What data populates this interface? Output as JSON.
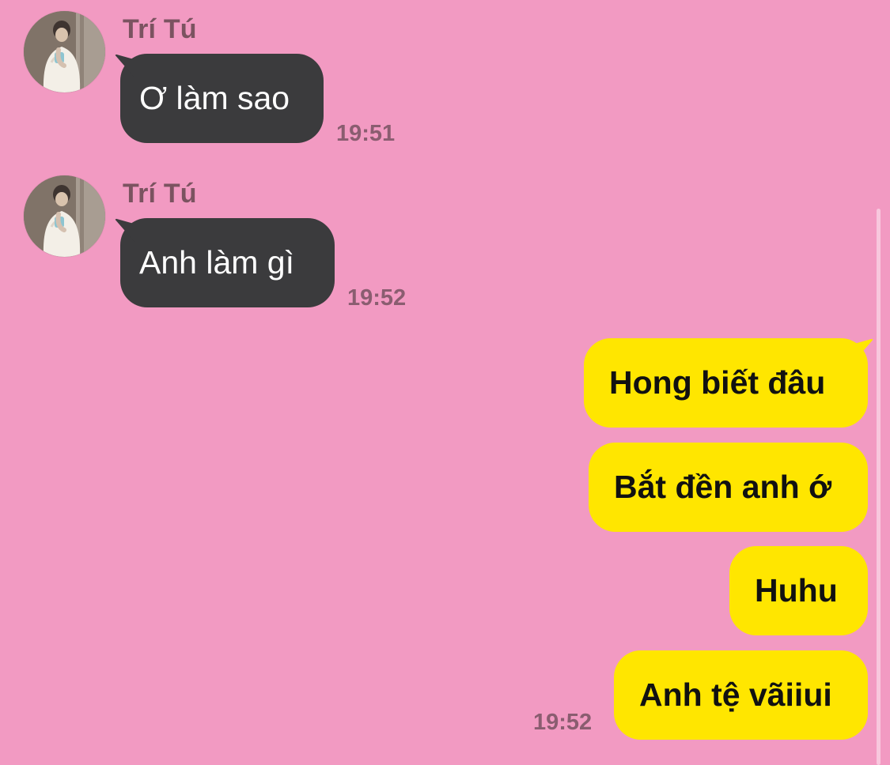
{
  "conversation": {
    "messages_in": [
      {
        "sender": "Trí Tú",
        "text": "Ơ làm sao",
        "time": "19:51"
      },
      {
        "sender": "Trí Tú",
        "text": "Anh làm gì",
        "time": "19:52"
      }
    ],
    "messages_out": [
      {
        "text": "Hong biết đâu"
      },
      {
        "text": "Bắt đền anh ớ"
      },
      {
        "text": "Huhu"
      },
      {
        "text": "Anh tệ vãiiui",
        "time": "19:52"
      }
    ]
  },
  "colors": {
    "background": "#F29AC2",
    "incoming_bubble": "#3B3B3D",
    "outgoing_bubble": "#FFE600",
    "incoming_text": "#FFFFFF",
    "outgoing_text": "#111111",
    "meta_text": "#8A5D70"
  },
  "icons": {
    "avatar": "user-avatar-photo"
  }
}
